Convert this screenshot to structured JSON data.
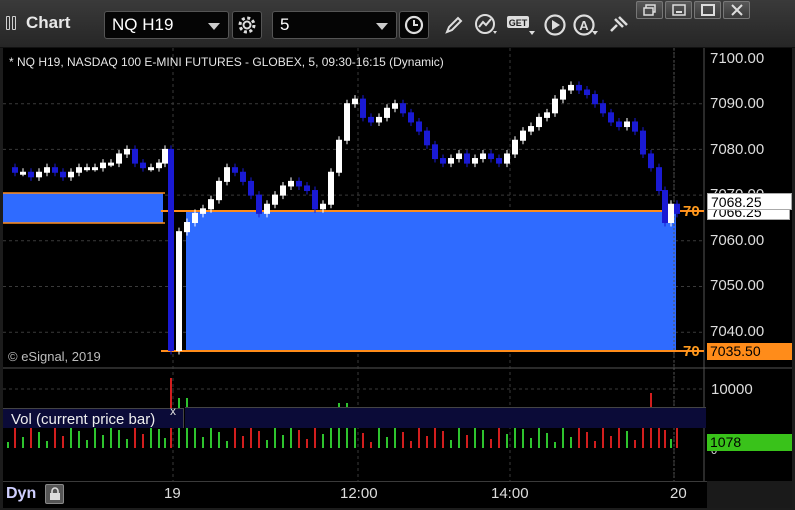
{
  "toolbar": {
    "title": "Chart",
    "symbol": "NQ H19",
    "interval": "5",
    "icons": [
      "settings-icon",
      "clock-icon",
      "pencil-icon",
      "study-icon",
      "get-icon",
      "play-icon",
      "a-icon",
      "pin-icon"
    ],
    "get_label": "GET",
    "a_label": "A"
  },
  "window_controls": [
    "restore-icon",
    "minimize-icon",
    "maximize-icon",
    "close-icon"
  ],
  "chart": {
    "header": "* NQ H19, NASDAQ 100 E-MINI FUTURES - GLOBEX, 5, 09:30-16:15 (Dynamic)",
    "watermark": "© eSignal, 2019",
    "colors": {
      "background": "#000000",
      "up_candle": "#ffffff",
      "down_candle": "#1a1ad4",
      "zone_fill": "#2f6bff",
      "line_orange": "#ff8c1a",
      "vol_up": "#2ec42e",
      "vol_down": "#d21e1e",
      "vol_tag": "#39c21a"
    },
    "price_axis": {
      "labels": [
        "7100.00",
        "7090.00",
        "7080.00",
        "7070.00",
        "7060.00",
        "7050.00",
        "7040.00"
      ],
      "last_price_tag": "7068.25",
      "hidden_tag": "7066.25",
      "bottom_tag": "7035.50",
      "line_labels": [
        "70",
        "70"
      ]
    },
    "volume_axis": {
      "labels": [
        "10000",
        "0"
      ],
      "last_volume_tag": "1078"
    },
    "time_axis": {
      "labels": [
        "19",
        "12:00",
        "14:00",
        "20"
      ],
      "mode": "Dyn"
    },
    "volume_pane_title": "Vol (current price bar)",
    "volume_pane_close": "x"
  }
}
